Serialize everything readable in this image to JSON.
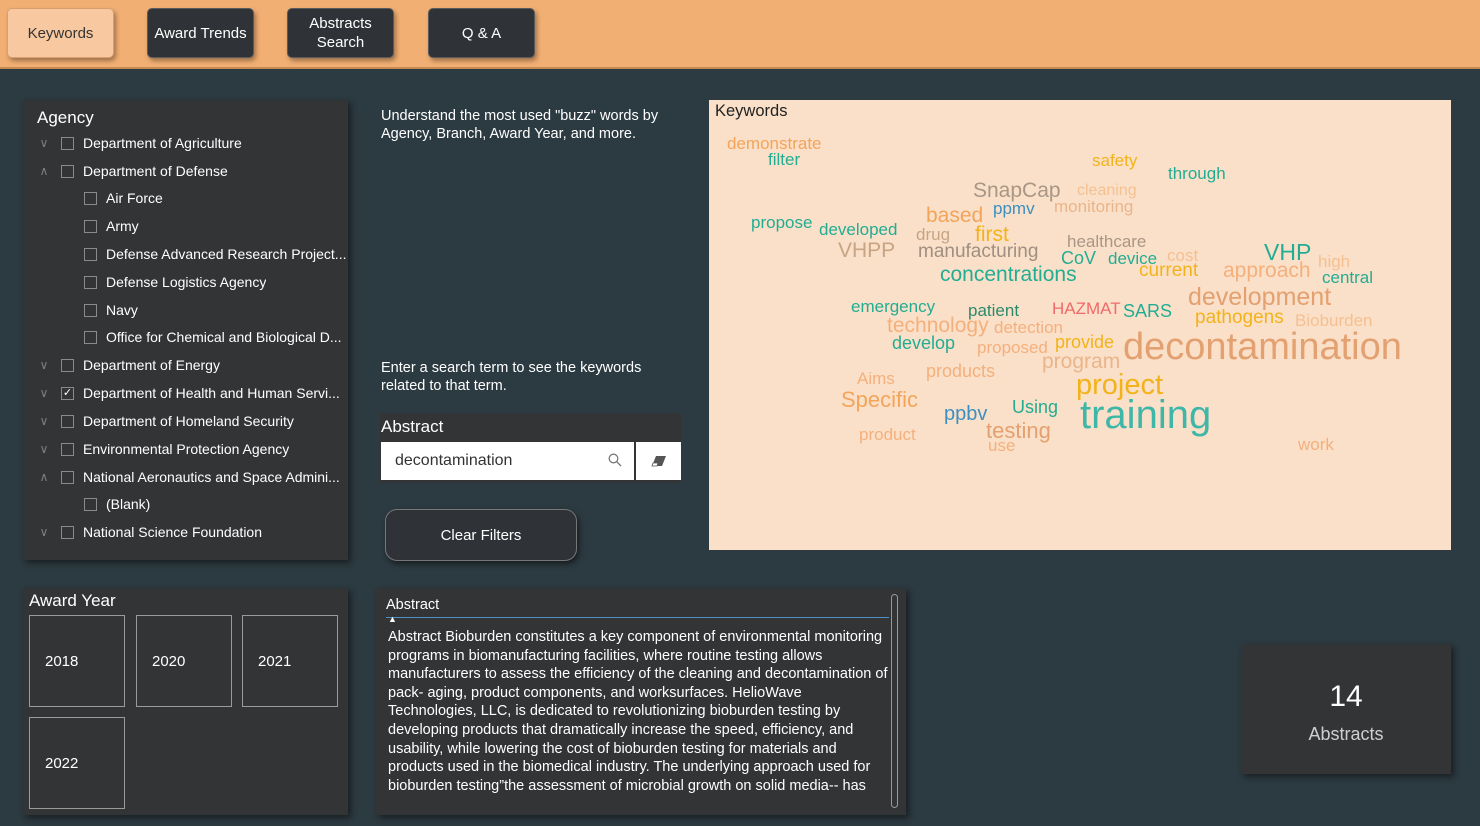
{
  "nav": {
    "buttons": [
      {
        "label": "Keywords"
      },
      {
        "label": "Award Trends"
      },
      {
        "label": "Abstracts\nSearch"
      },
      {
        "label": "Q & A"
      }
    ]
  },
  "agency": {
    "title": "Agency",
    "items": [
      {
        "label": "Department of Agriculture",
        "checked": false
      },
      {
        "label": "Department of Defense",
        "checked": false
      },
      {
        "label": "Air Force",
        "checked": false
      },
      {
        "label": "Army",
        "checked": false
      },
      {
        "label": "Defense Advanced Research Project...",
        "checked": false
      },
      {
        "label": "Defense Logistics Agency",
        "checked": false
      },
      {
        "label": "Navy",
        "checked": false
      },
      {
        "label": "Office for Chemical and Biological D...",
        "checked": false
      },
      {
        "label": "Department of Energy",
        "checked": false
      },
      {
        "label": "Department of Health and Human Servi...",
        "checked": true
      },
      {
        "label": "Department of Homeland Security",
        "checked": false
      },
      {
        "label": "Environmental Protection Agency",
        "checked": false
      },
      {
        "label": "National Aeronautics and Space Admini...",
        "checked": false
      },
      {
        "label": "(Blank)",
        "checked": false
      },
      {
        "label": "National Science Foundation",
        "checked": false
      }
    ]
  },
  "intro": {
    "text1": "Understand the most used \"buzz\" words by Agency, Branch, Award Year, and more.",
    "text2": "Enter a search term to see the keywords related to that term."
  },
  "search": {
    "label": "Abstract",
    "value": "decontamination"
  },
  "clear_filters": "Clear Filters",
  "cloud": {
    "title": "Keywords",
    "colors": {
      "teal": "#22ad93",
      "orange": "#f3a45a",
      "gold": "#f2b31a",
      "tan": "#c7a484",
      "gray": "#9f8f82",
      "blue": "#3d8fc0",
      "pink": "#ef6a6a",
      "darkgreen": "#2c8a6a",
      "lightorange": "#f4b07c"
    },
    "words": [
      {
        "text": "demonstrate",
        "color": "#f3a45a"
      },
      {
        "text": "filter",
        "color": "#22ad93"
      },
      {
        "text": "safety",
        "color": "#f2b31a"
      },
      {
        "text": "through",
        "color": "#22ad93"
      },
      {
        "text": "SnapCap",
        "color": "#a89686"
      },
      {
        "text": "cleaning",
        "color": "#f4c090"
      },
      {
        "text": "ppmv",
        "color": "#3d8fc0"
      },
      {
        "text": "monitoring",
        "color": "#e9b58b"
      },
      {
        "text": "based",
        "color": "#f3a45a"
      },
      {
        "text": "propose",
        "color": "#22ad93"
      },
      {
        "text": "developed",
        "color": "#22ad93"
      },
      {
        "text": "drug",
        "color": "#c7a484"
      },
      {
        "text": "first",
        "color": "#f2b31a"
      },
      {
        "text": "healthcare",
        "color": "#a89686"
      },
      {
        "text": "VHPP",
        "color": "#c7a484"
      },
      {
        "text": "manufacturing",
        "color": "#9f8f82"
      },
      {
        "text": "CoV",
        "color": "#22ad93"
      },
      {
        "text": "device",
        "color": "#22ad93"
      },
      {
        "text": "cost",
        "color": "#f4c090"
      },
      {
        "text": "VHP",
        "color": "#22ad93"
      },
      {
        "text": "high",
        "color": "#f4c090"
      },
      {
        "text": "current",
        "color": "#f2b31a"
      },
      {
        "text": "approach",
        "color": "#f4b07c"
      },
      {
        "text": "central",
        "color": "#22ad93"
      },
      {
        "text": "concentrations",
        "color": "#22ad93"
      },
      {
        "text": "development",
        "color": "#e3a070"
      },
      {
        "text": "emergency",
        "color": "#22ad93"
      },
      {
        "text": "patient",
        "color": "#2c8a6a"
      },
      {
        "text": "HAZMAT",
        "color": "#ef6a6a"
      },
      {
        "text": "SARS",
        "color": "#22ad93"
      },
      {
        "text": "pathogens",
        "color": "#f2b31a"
      },
      {
        "text": "Bioburden",
        "color": "#f4c090"
      },
      {
        "text": "technology",
        "color": "#f4b07c"
      },
      {
        "text": "detection",
        "color": "#f4b07c"
      },
      {
        "text": "develop",
        "color": "#22ad93"
      },
      {
        "text": "proposed",
        "color": "#f4b07c"
      },
      {
        "text": "provide",
        "color": "#f2b31a"
      },
      {
        "text": "program",
        "color": "#e9b58b"
      },
      {
        "text": "decontamination",
        "color": "#e3a070"
      },
      {
        "text": "Aims",
        "color": "#f4b07c"
      },
      {
        "text": "products",
        "color": "#f4b07c"
      },
      {
        "text": "project",
        "color": "#f2b31a"
      },
      {
        "text": "Specific",
        "color": "#f3a45a"
      },
      {
        "text": "ppbv",
        "color": "#3d8fc0"
      },
      {
        "text": "Using",
        "color": "#22ad93"
      },
      {
        "text": "training",
        "color": "#3fb7a8"
      },
      {
        "text": "testing",
        "color": "#e3a070"
      },
      {
        "text": "use",
        "color": "#f4b07c"
      },
      {
        "text": "product",
        "color": "#f4b07c"
      },
      {
        "text": "work",
        "color": "#f4b07c"
      }
    ]
  },
  "award_year": {
    "title": "Award Year",
    "years": [
      "2018",
      "2020",
      "2021",
      "2022"
    ]
  },
  "abstract_table": {
    "header": "Abstract",
    "text": "Abstract Bioburden constitutes a key component of environmental monitoring programs in biomanufacturing facilities, where routine testing allows manufacturers to assess the efficiency of the cleaning and decontamination of pack- aging, product components, and worksurfaces. HelioWave Technologies, LLC, is dedicated to revolutionizing bioburden testing by developing products that dramatically increase the speed, efficiency, and usability, while lowering the cost of bioburden testing for materials and products used in the biomedical industry. The underlying approach used for bioburden testing”the assessment of microbial growth on solid media-- has"
  },
  "card": {
    "value": "14",
    "label": "Abstracts"
  }
}
